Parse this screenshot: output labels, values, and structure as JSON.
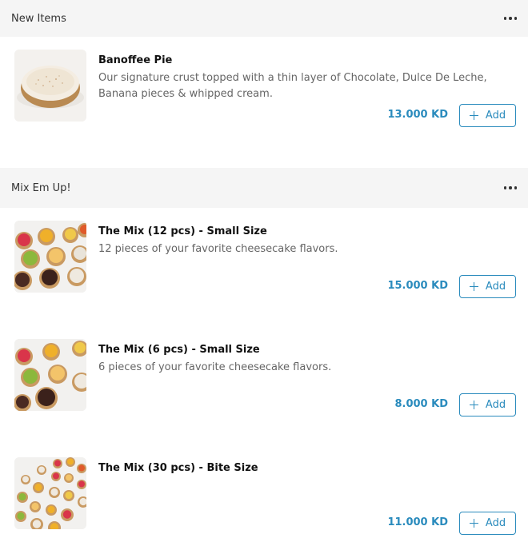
{
  "sections": [
    {
      "title": "New Items",
      "items": [
        {
          "name": "Banoffee Pie",
          "description": "Our signature crust topped with a thin layer of Chocolate, Dulce De Leche, Banana pieces & whipped cream.",
          "price": "13.000 KD",
          "add_label": "Add",
          "image": "banoffee-pie-photo"
        }
      ]
    },
    {
      "title": "Mix Em Up!",
      "items": [
        {
          "name": "The Mix (12 pcs) - Small Size",
          "description": "12 pieces of your favorite cheesecake flavors.",
          "price": "15.000 KD",
          "add_label": "Add",
          "image": "cheesecake-cups-photo"
        },
        {
          "name": "The Mix (6 pcs) - Small Size",
          "description": "6 pieces of your favorite cheesecake flavors.",
          "price": "8.000 KD",
          "add_label": "Add",
          "image": "cheesecake-cups-photo"
        },
        {
          "name": "The Mix (30 pcs) - Bite Size",
          "description": "",
          "price": "11.000 KD",
          "add_label": "Add",
          "image": "bite-size-cups-photo"
        }
      ]
    }
  ],
  "colors": {
    "accent": "#2a8bbd",
    "section_bg": "#f5f5f5"
  },
  "icons": {
    "more": "more-horizontal-icon",
    "add": "plus-icon"
  }
}
